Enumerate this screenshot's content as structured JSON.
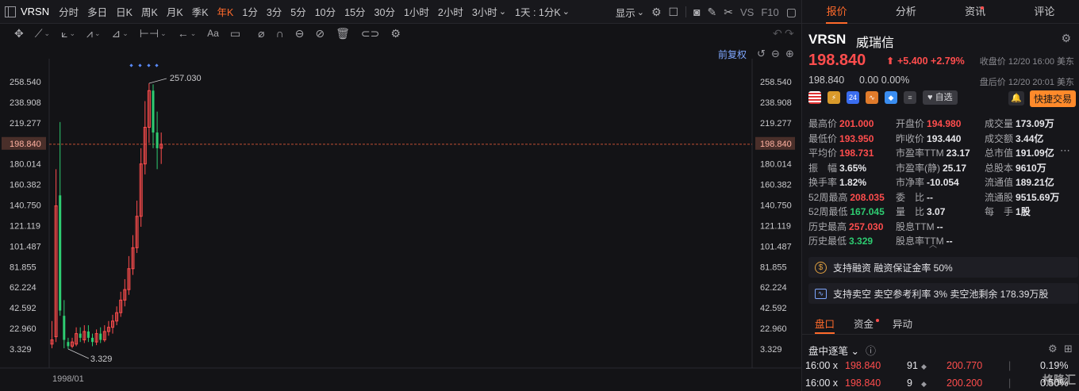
{
  "toolbar": {
    "ticker": "VRSN",
    "periods": [
      "分时",
      "多日",
      "日K",
      "周K",
      "月K",
      "季K",
      "年K",
      "1分",
      "3分",
      "5分",
      "10分",
      "15分",
      "30分",
      "1小时",
      "2小时",
      "3小时",
      "1天 : 1分K"
    ],
    "active_period": "年K",
    "display_label": "显示",
    "vs_label": "VS",
    "f10_label": "F10"
  },
  "chart": {
    "adjust_label": "前复权",
    "x_start_label": "1998/01",
    "high_label": "257.030",
    "low_label": "3.329",
    "current_price_label": "198.840",
    "y_ticks": [
      "258.540",
      "238.908",
      "219.277",
      "198.840",
      "180.014",
      "160.382",
      "140.750",
      "121.119",
      "101.487",
      "81.855",
      "62.224",
      "42.592",
      "22.960",
      "3.329"
    ],
    "colors": {
      "up": "#ff4d4d",
      "down": "#2ecc71",
      "price_line": "#e05a3a"
    }
  },
  "chart_data": {
    "type": "candlestick",
    "x_start_label": "1998/01",
    "ylim": [
      3.329,
      258.54
    ],
    "high": 257.03,
    "low": 3.329,
    "last": 198.84
  },
  "panel": {
    "tabs": [
      {
        "label": "报价",
        "active": true,
        "dot": false
      },
      {
        "label": "分析",
        "active": false,
        "dot": false
      },
      {
        "label": "资讯",
        "active": false,
        "dot": true
      },
      {
        "label": "评论",
        "active": false,
        "dot": false
      }
    ],
    "symbol": "VRSN",
    "name": "威瑞信",
    "price": "198.840",
    "change": "+5.400",
    "change_pct": "+2.79%",
    "close_info": "收盘价 12/20 16:00 美东",
    "after_price": "198.840",
    "after_change": "0.00 0.00%",
    "after_info": "盘后价 12/20 20:01 美东",
    "watchlist_label": "自选",
    "quick_trade_label": "快捷交易",
    "stats": [
      [
        {
          "l": "最高价",
          "v": "201.000",
          "c": "red"
        },
        {
          "l": "开盘价",
          "v": "194.980",
          "c": "red"
        },
        {
          "l": "成交量",
          "v": "173.09万",
          "c": ""
        }
      ],
      [
        {
          "l": "最低价",
          "v": "193.950",
          "c": "red"
        },
        {
          "l": "昨收价",
          "v": "193.440",
          "c": ""
        },
        {
          "l": "成交额",
          "v": "3.44亿",
          "c": ""
        }
      ],
      [
        {
          "l": "平均价",
          "v": "198.731",
          "c": "red"
        },
        {
          "l": "市盈率TTM",
          "v": "23.17",
          "c": ""
        },
        {
          "l": "总市值",
          "v": "191.09亿",
          "c": ""
        }
      ],
      [
        {
          "l": "振　幅",
          "v": "3.65%",
          "c": ""
        },
        {
          "l": "市盈率(静)",
          "v": "25.17",
          "c": ""
        },
        {
          "l": "总股本",
          "v": "9610万",
          "c": ""
        }
      ],
      [
        {
          "l": "换手率",
          "v": "1.82%",
          "c": ""
        },
        {
          "l": "市净率",
          "v": "-10.054",
          "c": ""
        },
        {
          "l": "流通值",
          "v": "189.21亿",
          "c": ""
        }
      ],
      [
        {
          "l": "52周最高",
          "v": "208.035",
          "c": "red"
        },
        {
          "l": "委　比",
          "v": "--",
          "c": ""
        },
        {
          "l": "流通股",
          "v": "9515.69万",
          "c": ""
        }
      ],
      [
        {
          "l": "52周最低",
          "v": "167.045",
          "c": "green"
        },
        {
          "l": "量　比",
          "v": "3.07",
          "c": ""
        },
        {
          "l": "每　手",
          "v": "1股",
          "c": ""
        }
      ],
      [
        {
          "l": "历史最高",
          "v": "257.030",
          "c": "red"
        },
        {
          "l": "股息TTM",
          "v": "--",
          "c": ""
        },
        null
      ],
      [
        {
          "l": "历史最低",
          "v": "3.329",
          "c": "green"
        },
        {
          "l": "股息率TTM",
          "v": "--",
          "c": ""
        },
        null
      ]
    ],
    "margin_text": "支持融资  融资保证金率 50%",
    "short_text": "支持卖空  卖空参考利率 3%  卖空池剩余 178.39万股",
    "bottom_tabs": [
      {
        "label": "盘口",
        "active": true,
        "dot": false
      },
      {
        "label": "资金",
        "active": false,
        "dot": true
      },
      {
        "label": "异动",
        "active": false,
        "dot": false
      }
    ],
    "tick_title": "盘中逐笔",
    "ticks": [
      {
        "time": "16:00 x",
        "price": "198.840",
        "vol": "91",
        "price2": "200.770",
        "pct": "0.19%"
      },
      {
        "time": "16:00 x",
        "price": "198.840",
        "vol": "9",
        "price2": "200.200",
        "pct": "0.50%"
      }
    ],
    "watermark": "格隆汇"
  }
}
